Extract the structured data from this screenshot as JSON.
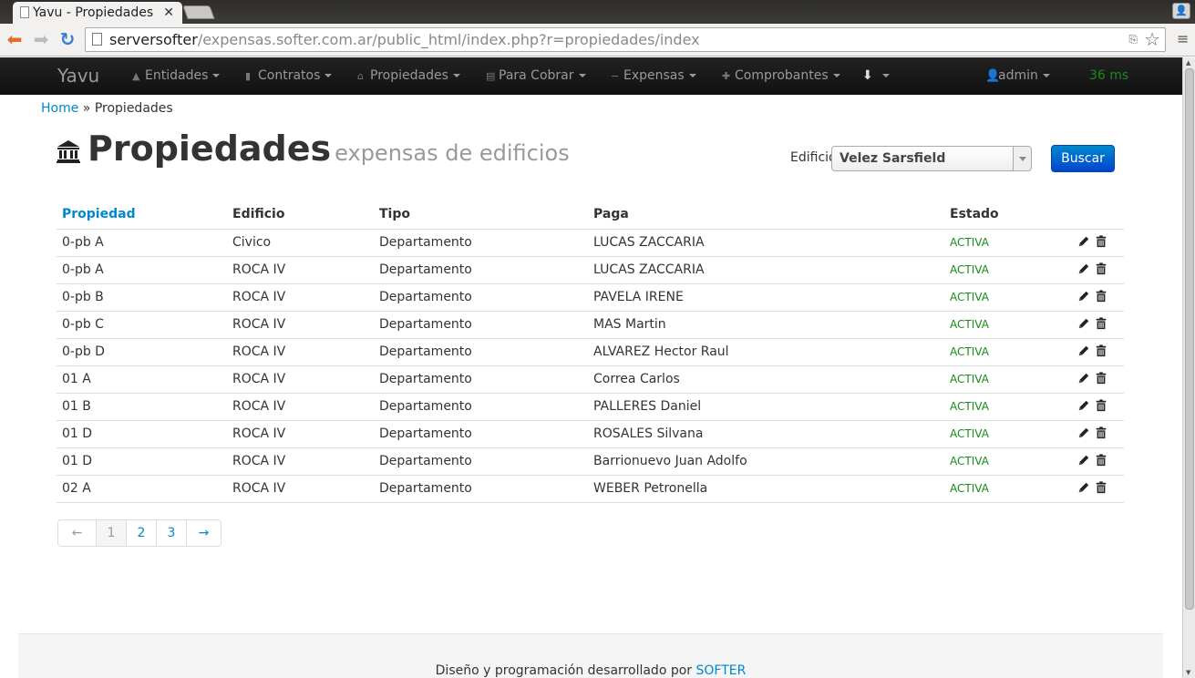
{
  "browser": {
    "tab_title": "Yavu - Propiedades",
    "url_host": "serversofter",
    "url_path": "/expensas.softer.com.ar/public_html/index.php?r=propiedades/index"
  },
  "navbar": {
    "brand": "Yavu",
    "items": [
      {
        "label": "Entidades",
        "icon": "user-icon"
      },
      {
        "label": "Contratos",
        "icon": "file-icon"
      },
      {
        "label": "Propiedades",
        "icon": "home-icon"
      },
      {
        "label": "Para Cobrar",
        "icon": "list-icon"
      },
      {
        "label": "Expensas",
        "icon": "minus-icon"
      },
      {
        "label": "Comprobantes",
        "icon": "plus-icon"
      }
    ],
    "download_icon": "download-icon",
    "user": "admin",
    "timer": "36 ms"
  },
  "breadcrumb": {
    "home": "Home",
    "separator": "»",
    "current": "Propiedades"
  },
  "header": {
    "title": "Propiedades",
    "subtitle": "expensas de edificios"
  },
  "filter": {
    "label": "Edificio",
    "value": "Velez Sarsfield",
    "button": "Buscar"
  },
  "table": {
    "columns": [
      "Propiedad",
      "Edificio",
      "Tipo",
      "Paga",
      "Estado"
    ],
    "rows": [
      {
        "propiedad": "0-pb A",
        "edificio": "Civico",
        "tipo": "Departamento",
        "paga": "LUCAS ZACCARIA",
        "estado": "ACTIVA"
      },
      {
        "propiedad": "0-pb A",
        "edificio": "ROCA IV",
        "tipo": "Departamento",
        "paga": "LUCAS ZACCARIA",
        "estado": "ACTIVA"
      },
      {
        "propiedad": "0-pb B",
        "edificio": "ROCA IV",
        "tipo": "Departamento",
        "paga": "PAVELA IRENE",
        "estado": "ACTIVA"
      },
      {
        "propiedad": "0-pb C",
        "edificio": "ROCA IV",
        "tipo": "Departamento",
        "paga": "MAS Martin",
        "estado": "ACTIVA"
      },
      {
        "propiedad": "0-pb D",
        "edificio": "ROCA IV",
        "tipo": "Departamento",
        "paga": "ALVAREZ Hector Raul",
        "estado": "ACTIVA"
      },
      {
        "propiedad": "01 A",
        "edificio": "ROCA IV",
        "tipo": "Departamento",
        "paga": "Correa Carlos",
        "estado": "ACTIVA"
      },
      {
        "propiedad": "01 B",
        "edificio": "ROCA IV",
        "tipo": "Departamento",
        "paga": "PALLERES Daniel",
        "estado": "ACTIVA"
      },
      {
        "propiedad": "01 D",
        "edificio": "ROCA IV",
        "tipo": "Departamento",
        "paga": "ROSALES Silvana",
        "estado": "ACTIVA"
      },
      {
        "propiedad": "01 D",
        "edificio": "ROCA IV",
        "tipo": "Departamento",
        "paga": "Barrionuevo Juan Adolfo",
        "estado": "ACTIVA"
      },
      {
        "propiedad": "02 A",
        "edificio": "ROCA IV",
        "tipo": "Departamento",
        "paga": "WEBER Petronella",
        "estado": "ACTIVA"
      }
    ]
  },
  "pagination": {
    "prev": "←",
    "pages": [
      "1",
      "2",
      "3"
    ],
    "current": "1",
    "next": "→"
  },
  "footer": {
    "text": "Diseño y programación desarrollado por",
    "link": "SOFTER"
  },
  "colors": {
    "link": "#0088cc",
    "status_active": "#1a8a1a",
    "navbar_bg": "#1b1b1b",
    "button_primary": "#0066cc"
  }
}
